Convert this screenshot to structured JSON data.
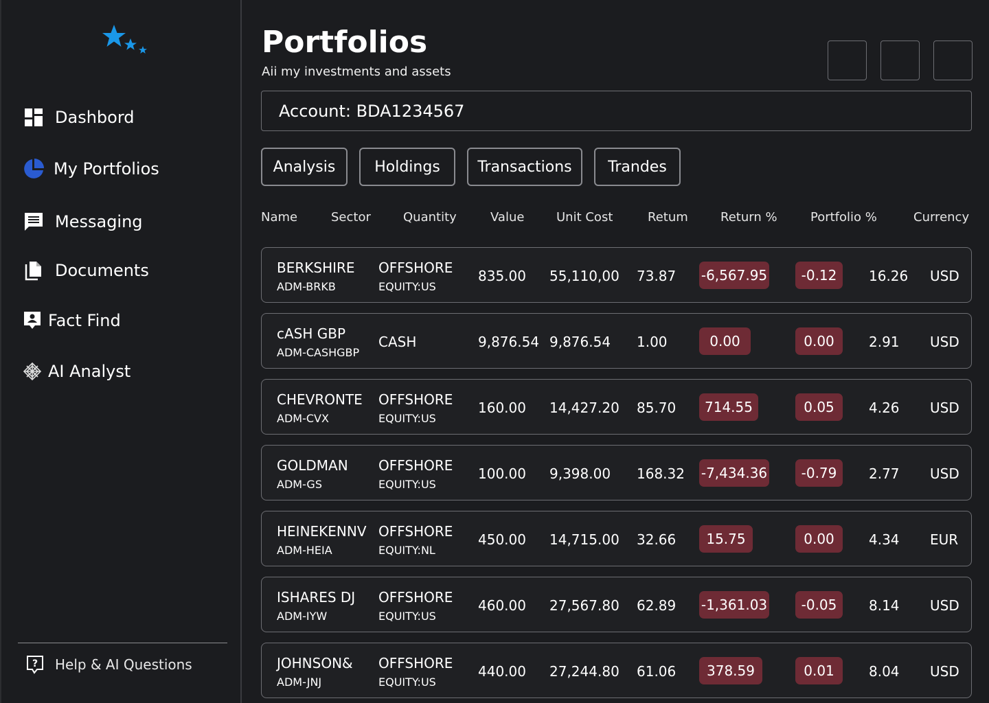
{
  "sidebar": {
    "nav": [
      {
        "label": "Dashbord",
        "icon": "dashboard-grid-icon"
      },
      {
        "label": "My Portfolios",
        "icon": "pie-chart-icon"
      },
      {
        "label": "Messaging",
        "icon": "message-icon"
      },
      {
        "label": "Documents",
        "icon": "documents-icon"
      },
      {
        "label": "Fact Find",
        "icon": "contact-card-icon"
      },
      {
        "label": "AI Analyst",
        "icon": "ai-chip-icon"
      }
    ],
    "help_label": "Help & AI Questions",
    "accent": "#1a97e8"
  },
  "header": {
    "title": "Portfolios",
    "subtitle": "Aii my investments and assets"
  },
  "account_label": "Account: BDA1234567",
  "tabs": [
    "Analysis",
    "Holdings",
    "Transactions",
    "Trandes"
  ],
  "columns": [
    "Name",
    "Sector",
    "Quantity",
    "Value",
    "Unit Cost",
    "Retum",
    "Return %",
    "Portfolio %",
    "Currency"
  ],
  "rows": [
    {
      "name": "BERKSHIRE",
      "code": "ADM-BRKB",
      "sector": "OFFSHORE",
      "sector_sub": "EQUITY:US",
      "quantity": "835.00",
      "value": "55,110,00",
      "unit_cost": "73.87",
      "return": "-6,567.95",
      "return_pct": "-0.12",
      "portfolio_pct": "16.26",
      "currency": "USD"
    },
    {
      "name": "cASH GBP",
      "code": "ADM-CASHGBP",
      "sector": "CASH",
      "sector_sub": "",
      "quantity": "9,876.54",
      "value": "9,876.54",
      "unit_cost": "1.00",
      "return": "0.00",
      "return_pct": "0.00",
      "portfolio_pct": "2.91",
      "currency": "USD"
    },
    {
      "name": "CHEVRONTE",
      "code": "ADM-CVX",
      "sector": "OFFSHORE",
      "sector_sub": "EQUITY:US",
      "quantity": "160.00",
      "value": "14,427.20",
      "unit_cost": "85.70",
      "return": "714.55",
      "return_pct": "0.05",
      "portfolio_pct": "4.26",
      "currency": "USD"
    },
    {
      "name": "GOLDMAN",
      "code": "ADM-GS",
      "sector": "OFFSHORE",
      "sector_sub": "EQUITY:US",
      "quantity": "100.00",
      "value": "9,398.00",
      "unit_cost": "168.32",
      "return": "-7,434.36",
      "return_pct": "-0.79",
      "portfolio_pct": "2.77",
      "currency": "USD"
    },
    {
      "name": "HEINEKENNV",
      "code": "ADM-HEIA",
      "sector": "OFFSHORE",
      "sector_sub": "EQUITY:NL",
      "quantity": "450.00",
      "value": "14,715.00",
      "unit_cost": "32.66",
      "return": "15.75",
      "return_pct": "0.00",
      "portfolio_pct": "4.34",
      "currency": "EUR"
    },
    {
      "name": "ISHARES DJ",
      "code": "ADM-IYW",
      "sector": "OFFSHORE",
      "sector_sub": "EQUITY:US",
      "quantity": "460.00",
      "value": "27,567.80",
      "unit_cost": "62.89",
      "return": "-1,361.03",
      "return_pct": "-0.05",
      "portfolio_pct": "8.14",
      "currency": "USD"
    },
    {
      "name": "JOHNSON&",
      "code": "ADM-JNJ",
      "sector": "OFFSHORE",
      "sector_sub": "EQUITY:US",
      "quantity": "440.00",
      "value": "27,244.80",
      "unit_cost": "61.06",
      "return": "378.59",
      "return_pct": "0.01",
      "portfolio_pct": "8.04",
      "currency": "USD"
    }
  ],
  "colors": {
    "background": "#1b1c1f",
    "pill": "#6e2b35",
    "border": "#6d6e73"
  }
}
